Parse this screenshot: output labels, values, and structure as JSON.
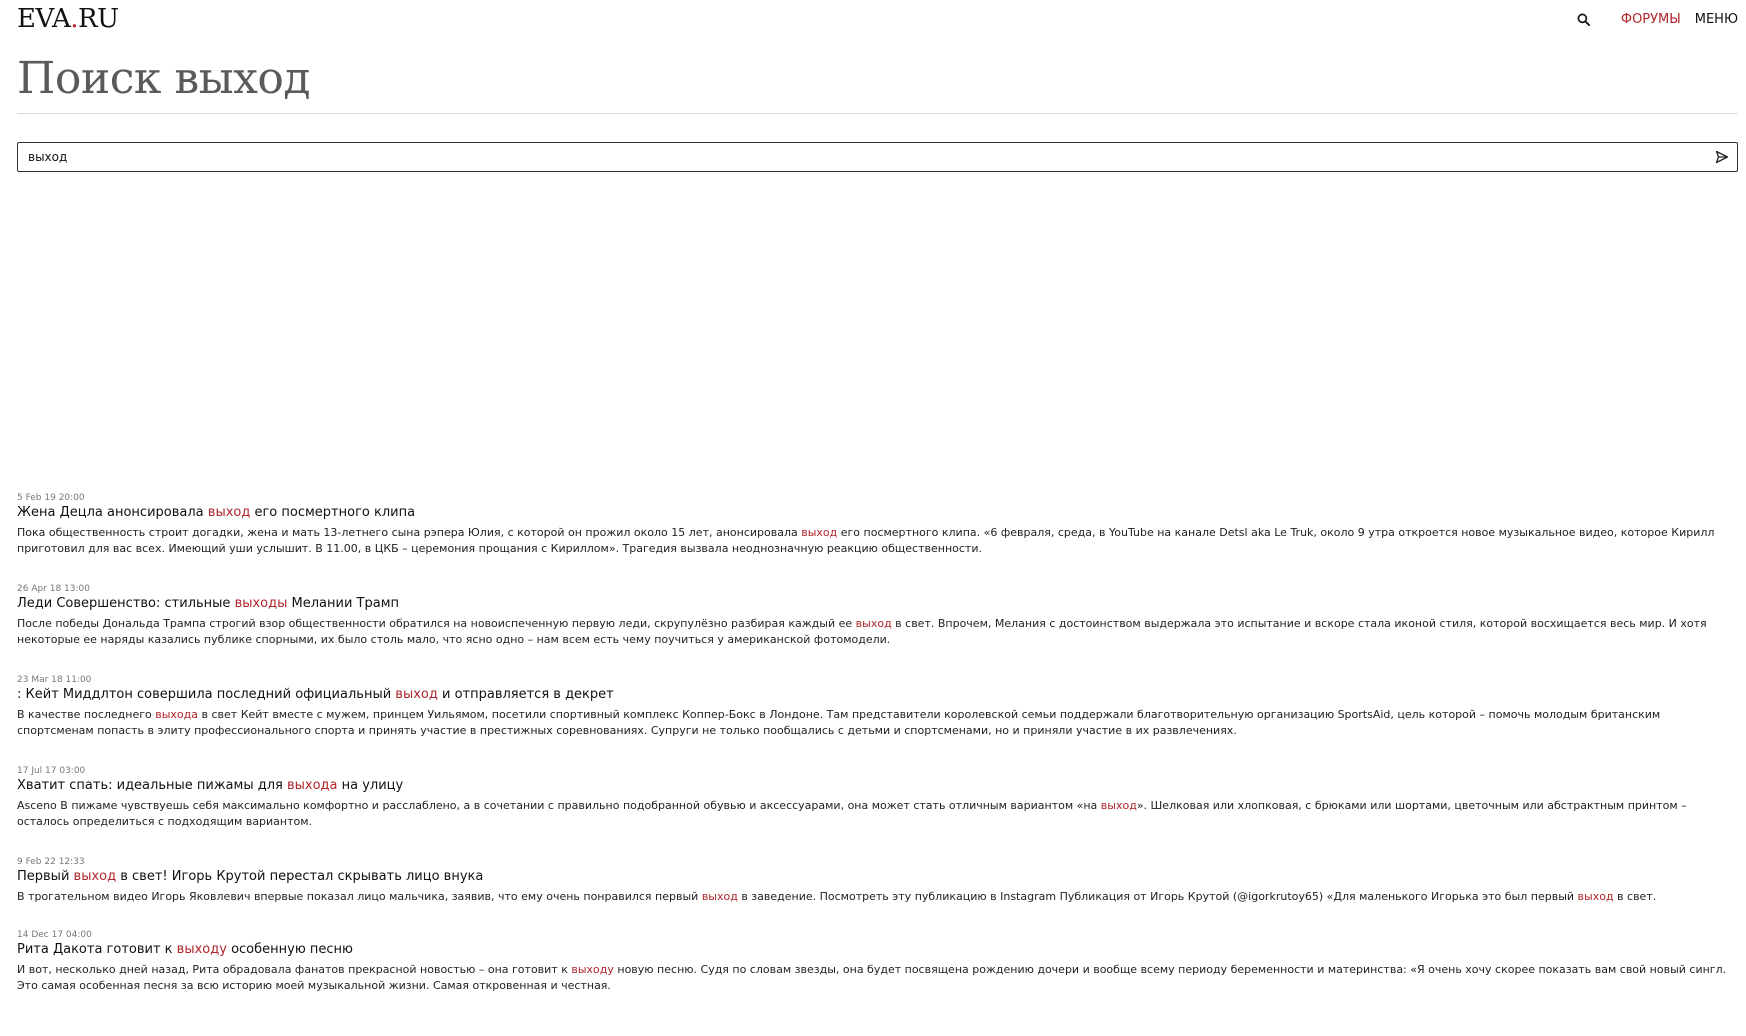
{
  "header": {
    "logo_left": "EVA",
    "logo_dot": ".",
    "logo_right": "RU",
    "nav": {
      "forums": "ФОРУМЫ",
      "menu": "МЕНЮ"
    },
    "search_icon": "search-icon"
  },
  "page_title": "Поиск выход",
  "search": {
    "value": "выход",
    "placeholder": "",
    "send_icon": "send-icon"
  },
  "highlight_color": "#b0262b",
  "results": [
    {
      "date": "5 Feb 19 20:00",
      "title_parts": [
        "Жена Децла анонсировала ",
        "выход",
        " его посмертного клипа"
      ],
      "snippet_parts": [
        "Пока общественность строит догадки, жена и мать 13-летнего сына рэпера Юлия, с которой он прожил около 15 лет, анонсировала ",
        "выход",
        " его посмертного клипа. «6 февраля, среда, в YouTube на канале Detsl aka Le Truk, около 9 утра откроется новое музыкальное видео, которое Кирилл приготовил для вас всех. Имеющий уши услышит. В 11.00, в ЦКБ – церемония прощания с Кириллом». Трагедия вызвала неоднозначную реакцию общественности."
      ]
    },
    {
      "date": "26 Apr 18 13:00",
      "title_parts": [
        "Леди Совершенство: стильные ",
        "выходы",
        " Мелании Трамп"
      ],
      "snippet_parts": [
        "После победы Дональда Трампа строгий взор общественности обратился на новоиспеченную первую леди, скрупулёзно разбирая каждый ее ",
        "выход",
        " в свет. Впрочем, Мелания с достоинством выдержала это испытание и вскоре стала иконой стиля, которой восхищается весь мир. И хотя некоторые ее наряды казались публике спорными, их было столь мало, что ясно одно – нам всем есть чему поучиться у американской фотомодели."
      ]
    },
    {
      "date": "23 Mar 18 11:00",
      "title_parts": [
        ": Кейт Миддлтон совершила последний официальный ",
        "выход",
        " и отправляется в декрет"
      ],
      "snippet_parts": [
        "В качестве последнего ",
        "выхода",
        " в свет Кейт вместе с мужем, принцем Уильямом, посетили спортивный комплекс Коппер-Бокс в Лондоне. Там представители королевской семьи поддержали благотворительную организацию SportsAid, цель которой – помочь молодым британским спортсменам попасть в элиту профессионального спорта и принять участие в престижных соревнованиях. Супруги не только пообщались с детьми и спортсменами, но и приняли участие в их развлечениях."
      ]
    },
    {
      "date": "17 Jul 17 03:00",
      "title_parts": [
        "Хватит спать: идеальные пижамы для ",
        "выхода",
        " на улицу"
      ],
      "snippet_parts": [
        "Asceno В пижаме чувствуешь себя максимально комфортно и расслаблено, а в сочетании с правильно подобранной обувью и аксессуарами, она может стать отличным вариантом «на ",
        "выход",
        "». Шелковая или хлопковая, с брюками или шортами, цветочным или абстрактным принтом – осталось определиться с подходящим вариантом."
      ]
    },
    {
      "date": "9 Feb 22 12:33",
      "title_parts": [
        "Первый ",
        "выход",
        " в свет! Игорь Крутой перестал скрывать лицо внука"
      ],
      "snippet_parts": [
        "В трогательном видео Игорь Яковлевич впервые показал лицо мальчика, заявив, что ему очень понравился первый ",
        "выход",
        " в заведение. Посмотреть эту публикацию в Instagram Публикация от Игорь Крутой (@igorkrutoy65) «Для маленького Игорька это был первый ",
        "выход",
        " в свет."
      ]
    },
    {
      "date": "14 Dec 17 04:00",
      "title_parts": [
        "Рита Дакота готовит к ",
        "выходу",
        " особенную песню"
      ],
      "snippet_parts": [
        "И вот, несколько дней назад, Рита обрадовала фанатов прекрасной новостью – она готовит к ",
        "выходу",
        " новую песню. Судя по словам звезды, она будет посвящена рождению дочери и вообще всему периоду беременности и материнства: «Я очень хочу скорее показать вам свой новый сингл. Это самая особенная песня за всю историю моей музыкальной жизни. Самая откровенная и честная."
      ]
    }
  ]
}
